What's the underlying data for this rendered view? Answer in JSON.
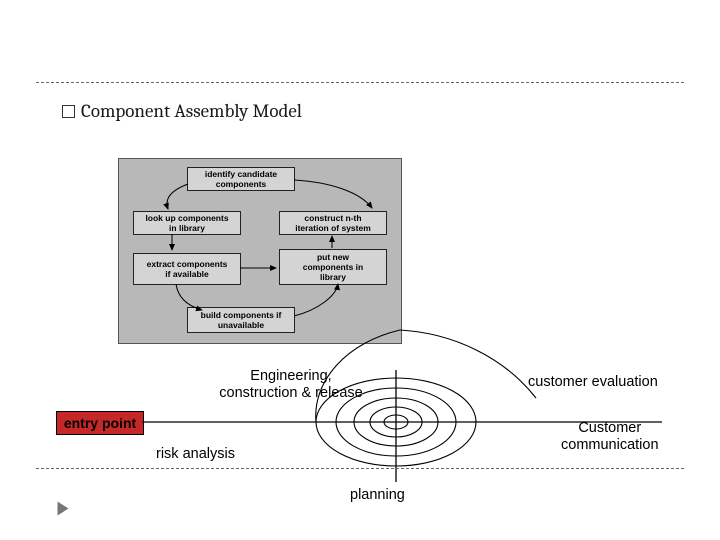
{
  "title": "Component Assembly Model",
  "nodes": {
    "identify": "identify candidate\ncomponents",
    "lookup": "look up components\nin library",
    "construct": "construct   n-th\niteration of system",
    "extract": "extract components\nif available",
    "putnew": "put new\ncomponents in\nlibrary",
    "build": "build components if\nunavailable"
  },
  "sectors": {
    "engineering": "Engineering,\nconstruction & release",
    "customer_eval": "customer evaluation",
    "customer_comm": "Customer\ncommunication",
    "risk": "risk analysis",
    "planning": "planning"
  },
  "entry": "entry point"
}
